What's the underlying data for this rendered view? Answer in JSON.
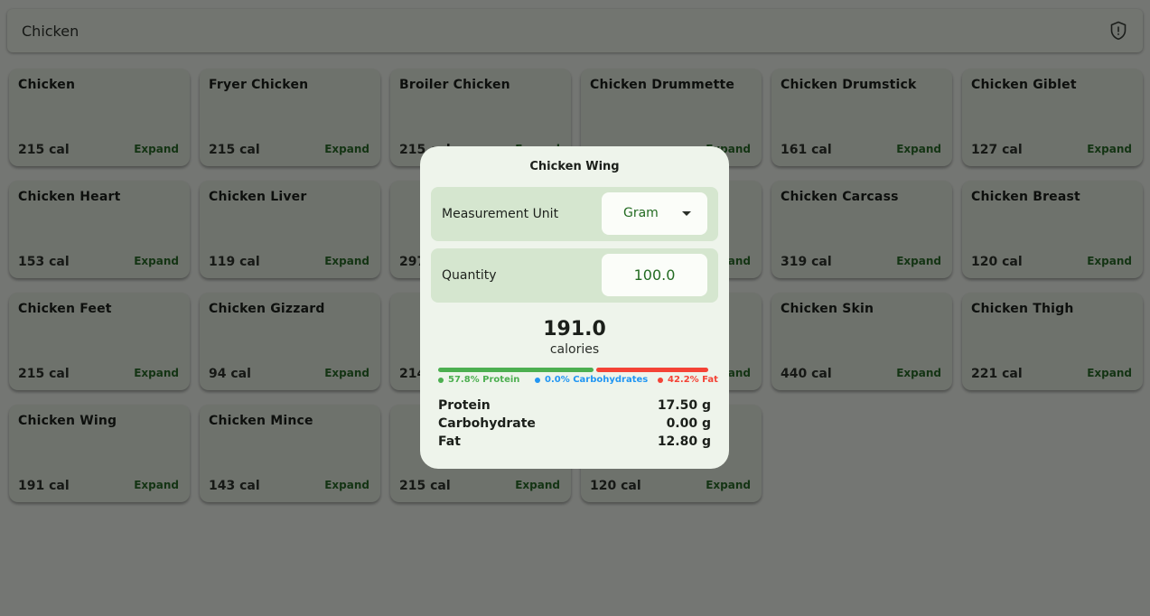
{
  "search": {
    "value": "Chicken",
    "icon": "shield-icon"
  },
  "foods": [
    {
      "name": "Chicken",
      "cal": "215 cal",
      "action": "Expand"
    },
    {
      "name": "Fryer Chicken",
      "cal": "215 cal",
      "action": "Expand"
    },
    {
      "name": "Broiler Chicken",
      "cal": "215 cal",
      "action": "Expand"
    },
    {
      "name": "Chicken Drummette",
      "cal": "",
      "action": "Expand"
    },
    {
      "name": "Chicken Drumstick",
      "cal": "161 cal",
      "action": "Expand"
    },
    {
      "name": "Chicken Giblet",
      "cal": "127 cal",
      "action": "Expand"
    },
    {
      "name": "Chicken Heart",
      "cal": "153 cal",
      "action": "Expand"
    },
    {
      "name": "Chicken Liver",
      "cal": "119 cal",
      "action": "Expand"
    },
    {
      "name": "",
      "cal": "297",
      "action": ""
    },
    {
      "name": "",
      "cal": "",
      "action": "Expand"
    },
    {
      "name": "Chicken Carcass",
      "cal": "319 cal",
      "action": "Expand"
    },
    {
      "name": "Chicken Breast",
      "cal": "120 cal",
      "action": "Expand"
    },
    {
      "name": "Chicken Feet",
      "cal": "215 cal",
      "action": "Expand"
    },
    {
      "name": "Chicken Gizzard",
      "cal": "94 cal",
      "action": "Expand"
    },
    {
      "name": "",
      "cal": "214",
      "action": ""
    },
    {
      "name": "",
      "cal": "",
      "action": "Expand"
    },
    {
      "name": "Chicken Skin",
      "cal": "440 cal",
      "action": "Expand"
    },
    {
      "name": "Chicken Thigh",
      "cal": "221 cal",
      "action": "Expand"
    },
    {
      "name": "Chicken Wing",
      "cal": "191 cal",
      "action": "Expand"
    },
    {
      "name": "Chicken Mince",
      "cal": "143 cal",
      "action": "Expand"
    },
    {
      "name": "",
      "cal": "215 cal",
      "action": "Expand"
    },
    {
      "name": "",
      "cal": "120 cal",
      "action": "Expand"
    }
  ],
  "dialog": {
    "title": "Chicken Wing",
    "unit_label": "Measurement Unit",
    "unit_value": "Gram",
    "quantity_label": "Quantity",
    "quantity_value": "100.0",
    "calories": "191.0",
    "calories_label": "calories",
    "protein_pct": 57.8,
    "carb_pct": 0.0,
    "fat_pct": 42.2,
    "protein_legend": "57.8% Protein",
    "carb_legend": "0.0% Carbohydrates",
    "fat_legend": "42.2% Fat",
    "nutrients": [
      {
        "name": "Protein",
        "value": "17.50 g"
      },
      {
        "name": "Carbohydrate",
        "value": "0.00 g"
      },
      {
        "name": "Fat",
        "value": "12.80 g"
      }
    ]
  },
  "colors": {
    "protein": "#4caf50",
    "carbs": "#2196f3",
    "fat": "#f44336",
    "accent": "#236b22"
  }
}
